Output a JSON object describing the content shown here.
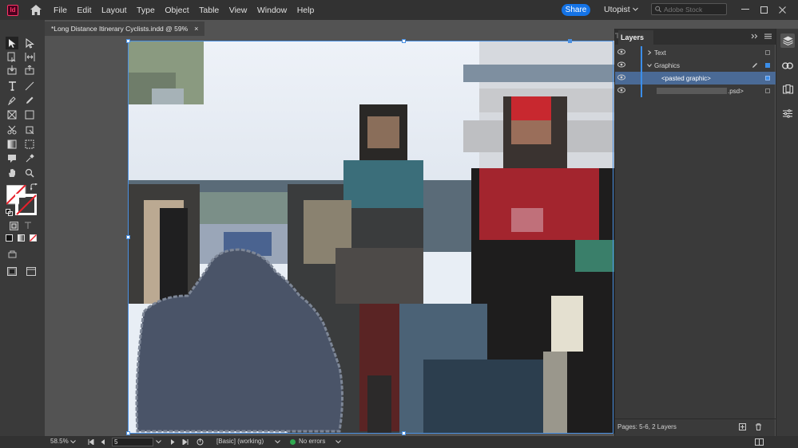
{
  "app": {
    "logo_text": "Id",
    "menus": [
      "File",
      "Edit",
      "Layout",
      "Type",
      "Object",
      "Table",
      "View",
      "Window",
      "Help"
    ],
    "share_label": "Share",
    "workspace": "Utopist",
    "stock_placeholder": "Adobe Stock"
  },
  "document": {
    "tab_title": "*Long Distance Itinerary Cyclists.indd @ 59%",
    "close_glyph": "×"
  },
  "layers_panel": {
    "title": "Layers",
    "rows": [
      {
        "label": "Text"
      },
      {
        "label": "Graphics"
      },
      {
        "label": "<pasted graphic>"
      },
      {
        "label": ".psd>"
      }
    ],
    "footer": "Pages: 5-6, 2 Layers"
  },
  "status": {
    "zoom": "58.5%",
    "page": "5",
    "style": "[Basic] (working)",
    "preflight": "No errors"
  },
  "colors": {
    "accent": "#1473e6",
    "layer_color": "#3b8eea",
    "selection": "#4a90e2"
  }
}
